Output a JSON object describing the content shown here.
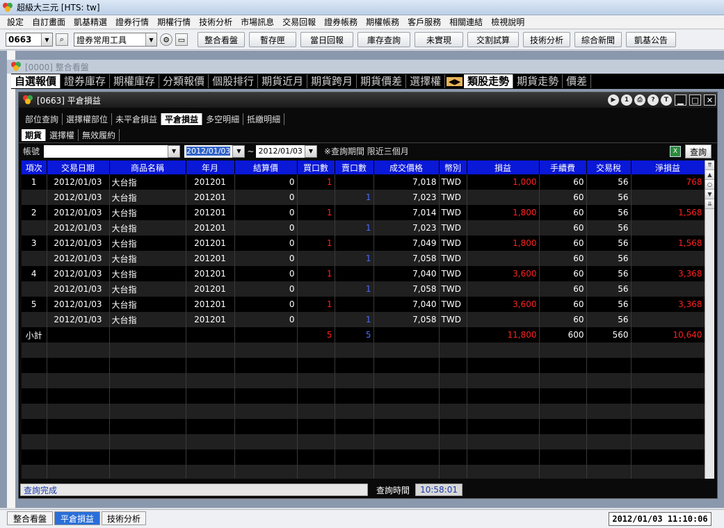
{
  "app": {
    "title": "超級大三元 [HTS: tw]"
  },
  "menu": [
    "設定",
    "自訂畫面",
    "凱基精選",
    "證券行情",
    "期權行情",
    "技術分析",
    "市場訊息",
    "交易回報",
    "證券帳務",
    "期權帳務",
    "客戶服務",
    "相關連結",
    "檢視說明"
  ],
  "toolbar": {
    "code": "0663",
    "tool_select": "證券常用工具",
    "buttons": [
      "整合看盤",
      "暫存匣",
      "當日回報",
      "庫存查詢",
      "未實現",
      "交割試算",
      "技術分析",
      "綜合新聞",
      "凱基公告"
    ]
  },
  "bg_window": {
    "title": "[0000] 整合看盤"
  },
  "big_tabs": [
    "自選報價",
    "證券庫存",
    "期權庫存",
    "分類報價",
    "個股排行",
    "期貨近月",
    "期貨跨月",
    "期貨價差",
    "選擇權",
    "類股走勢",
    "期貨走勢",
    "價差"
  ],
  "big_tabs_active": "類股走勢",
  "window": {
    "title": "[0663] 平倉損益",
    "title_buttons": [
      "▶",
      "1",
      "⎙",
      "?",
      "T"
    ]
  },
  "sub_tabs": [
    "部位查詢",
    "選擇權部位",
    "未平倉損益",
    "平倉損益",
    "多空明細",
    "抵繳明細"
  ],
  "sub_tabs_active": "平倉損益",
  "type_tabs": [
    "期貨",
    "選擇權",
    "無效履約"
  ],
  "type_tabs_active": "期貨",
  "filter": {
    "account_label": "帳號",
    "date_from": "2012/01/03",
    "tilde": "~",
    "date_to": "2012/01/03",
    "note": "※查詢期間 限近三個月",
    "query_label": "查詢",
    "xls_icon": "X"
  },
  "table": {
    "headers": [
      "項次",
      "交易日期",
      "商品名稱",
      "年月",
      "結算價",
      "買口數",
      "賣口數",
      "成交價格",
      "幣別",
      "損益",
      "手續費",
      "交易稅",
      "淨損益"
    ],
    "rows": [
      [
        "1",
        "2012/01/03",
        "大台指",
        "201201",
        "0",
        "1",
        "",
        "7,018",
        "TWD",
        "1,000",
        "60",
        "56",
        "768"
      ],
      [
        "",
        "2012/01/03",
        "大台指",
        "201201",
        "0",
        "",
        "1",
        "7,023",
        "TWD",
        "",
        "60",
        "56",
        ""
      ],
      [
        "2",
        "2012/01/03",
        "大台指",
        "201201",
        "0",
        "1",
        "",
        "7,014",
        "TWD",
        "1,800",
        "60",
        "56",
        "1,568"
      ],
      [
        "",
        "2012/01/03",
        "大台指",
        "201201",
        "0",
        "",
        "1",
        "7,023",
        "TWD",
        "",
        "60",
        "56",
        ""
      ],
      [
        "3",
        "2012/01/03",
        "大台指",
        "201201",
        "0",
        "1",
        "",
        "7,049",
        "TWD",
        "1,800",
        "60",
        "56",
        "1,568"
      ],
      [
        "",
        "2012/01/03",
        "大台指",
        "201201",
        "0",
        "",
        "1",
        "7,058",
        "TWD",
        "",
        "60",
        "56",
        ""
      ],
      [
        "4",
        "2012/01/03",
        "大台指",
        "201201",
        "0",
        "1",
        "",
        "7,040",
        "TWD",
        "3,600",
        "60",
        "56",
        "3,368"
      ],
      [
        "",
        "2012/01/03",
        "大台指",
        "201201",
        "0",
        "",
        "1",
        "7,058",
        "TWD",
        "",
        "60",
        "56",
        ""
      ],
      [
        "5",
        "2012/01/03",
        "大台指",
        "201201",
        "0",
        "1",
        "",
        "7,040",
        "TWD",
        "3,600",
        "60",
        "56",
        "3,368"
      ],
      [
        "",
        "2012/01/03",
        "大台指",
        "201201",
        "0",
        "",
        "1",
        "7,058",
        "TWD",
        "",
        "60",
        "56",
        ""
      ],
      [
        "小計",
        "",
        "",
        "",
        "",
        "5",
        "5",
        "",
        "",
        "11,800",
        "600",
        "560",
        "10,640"
      ]
    ]
  },
  "status": {
    "message": "查詢完成",
    "query_time_label": "查詢時間",
    "query_time": "10:58:01"
  },
  "taskbar": {
    "tabs": [
      "整合看盤",
      "平倉損益",
      "技術分析"
    ],
    "active": "平倉損益",
    "clock": "2012/01/03 11:10:06"
  },
  "colors": {
    "header_blue": "#0a18d8",
    "profit_red": "#ff2020",
    "sell_blue": "#4a6dff"
  }
}
